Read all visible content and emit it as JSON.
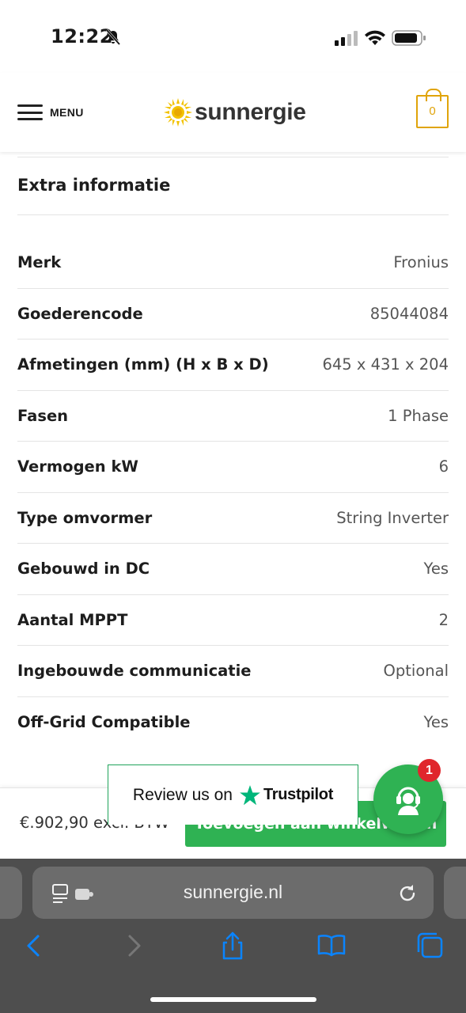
{
  "status_bar": {
    "time": "12:22",
    "icons": [
      "bell-muted-icon",
      "cellular-signal-icon",
      "wifi-icon",
      "battery-icon"
    ]
  },
  "header": {
    "menu_label": "MENU",
    "logo_text": "sunnergie",
    "cart_count": "0",
    "colors": {
      "accent": "#e0a40a"
    }
  },
  "section": {
    "title": "Extra informatie"
  },
  "specs": [
    {
      "key": "Merk",
      "value": "Fronius"
    },
    {
      "key": "Goederencode",
      "value": "85044084"
    },
    {
      "key": "Afmetingen (mm) (H x B x D)",
      "value": "645 x 431 x 204"
    },
    {
      "key": "Fasen",
      "value": "1 Phase"
    },
    {
      "key": "Vermogen kW",
      "value": "6"
    },
    {
      "key": "Type omvormer",
      "value": "String Inverter"
    },
    {
      "key": "Gebouwd in DC",
      "value": "Yes"
    },
    {
      "key": "Aantal MPPT",
      "value": "2"
    },
    {
      "key": "Ingebouwde communicatie",
      "value": "Optional"
    },
    {
      "key": "Off-Grid Compatible",
      "value": "Yes"
    }
  ],
  "sticky_bar": {
    "price": "€.902,90 excl. BTW",
    "add_button": "Toevoegen aan winkelwagen",
    "colors": {
      "button": "#2fb253"
    }
  },
  "trustpilot": {
    "text": "Review us on",
    "brand": "Trustpilot",
    "colors": {
      "star": "#00b67a"
    }
  },
  "chat": {
    "badge_count": "1",
    "colors": {
      "fab": "#2fb253",
      "badge": "#e0262c"
    }
  },
  "browser": {
    "url": "sunnergie.nl",
    "toolbar_icons": [
      "back-icon",
      "forward-icon",
      "share-icon",
      "bookmarks-icon",
      "tabs-icon"
    ],
    "colors": {
      "icon": "#0a84ff"
    }
  }
}
